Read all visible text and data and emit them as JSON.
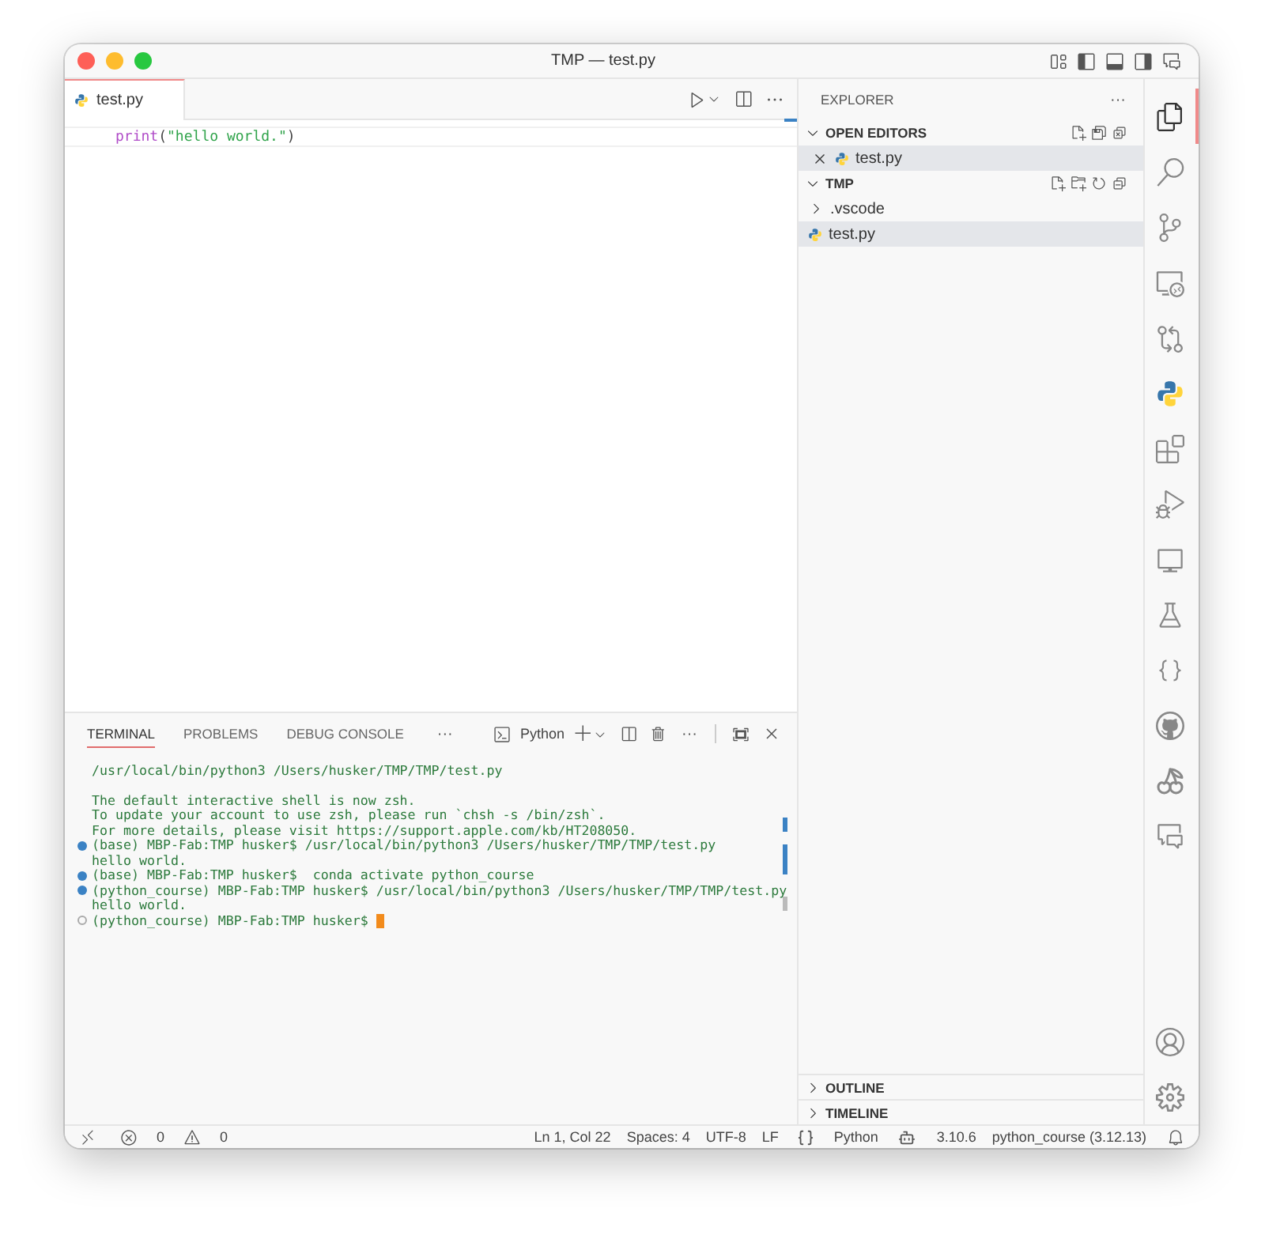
{
  "window": {
    "title": "TMP — test.py"
  },
  "editor": {
    "tabs": [
      {
        "label": "test.py",
        "selected": true
      }
    ],
    "code": [
      {
        "kind": "function",
        "text": "print"
      },
      {
        "kind": "punct",
        "text": "("
      },
      {
        "kind": "string",
        "text": "\"hello world.\""
      },
      {
        "kind": "punct",
        "text": ")"
      }
    ]
  },
  "panel": {
    "tabs": [
      {
        "label": "TERMINAL",
        "selected": true
      },
      {
        "label": "PROBLEMS",
        "selected": false
      },
      {
        "label": "DEBUG CONSOLE",
        "selected": false
      }
    ],
    "more": "···",
    "shell": "Python",
    "actions_more": "···",
    "terminal": {
      "cursor": true,
      "blocks": [
        [
          {
            "kind": "plain",
            "text": "/usr/local/bin/python3 /Users/husker/TMP/TMP/test.py"
          }
        ],
        [
          {
            "kind": "plain",
            "text": "The default interactive shell is now zsh."
          },
          {
            "kind": "plain",
            "text": "To update your account to use zsh, please run `chsh -s /bin/zsh`."
          },
          {
            "kind": "plain",
            "text": "For more details, please visit https://support.apple.com/kb/HT208050."
          },
          {
            "kind": "success",
            "text": "(base) MBP-Fab:TMP husker$ /usr/local/bin/python3 /Users/husker/TMP/TMP/test.py"
          },
          {
            "kind": "plain",
            "text": "hello world."
          },
          {
            "kind": "success",
            "text": "(base) MBP-Fab:TMP husker$  conda activate python_course"
          },
          {
            "kind": "success",
            "text": "(python_course) MBP-Fab:TMP husker$ /usr/local/bin/python3 /Users/husker/TMP/TMP/test.py"
          },
          {
            "kind": "plain",
            "text": "hello world."
          },
          {
            "kind": "pending",
            "text": "(python_course) MBP-Fab:TMP husker$ "
          }
        ]
      ]
    }
  },
  "sidebar": {
    "title": "EXPLORER",
    "more": "···",
    "sections": [
      {
        "kind": "open-editors",
        "label": "OPEN EDITORS",
        "expanded": true,
        "items": [
          {
            "label": "test.py",
            "kind": "python",
            "selected": true
          }
        ]
      },
      {
        "kind": "folder",
        "label": "TMP",
        "expanded": true,
        "items": [
          {
            "label": ".vscode",
            "kind": "folder",
            "selected": false,
            "expanded": false
          },
          {
            "label": "test.py",
            "kind": "python",
            "selected": true
          }
        ]
      }
    ],
    "bottom_sections": [
      {
        "label": "OUTLINE",
        "expanded": false
      },
      {
        "label": "TIMELINE",
        "expanded": false
      }
    ]
  },
  "activity_bar": {
    "items": [
      {
        "selected": true
      },
      {
        "selected": false
      },
      {
        "selected": false
      },
      {
        "selected": false
      },
      {
        "selected": false
      },
      {
        "selected": false
      },
      {
        "selected": false
      },
      {
        "selected": false
      },
      {
        "selected": false
      },
      {
        "selected": false
      },
      {
        "selected": false
      },
      {
        "selected": false
      },
      {
        "selected": false
      },
      {
        "selected": false
      }
    ]
  },
  "status_bar": {
    "errors": "0",
    "warnings": "0",
    "items": [
      "Ln 1, Col 22",
      "Spaces: 4",
      "UTF-8",
      "LF"
    ],
    "language": "Python",
    "python_version": "3.10.6",
    "environment": "python_course (3.12.13)"
  }
}
